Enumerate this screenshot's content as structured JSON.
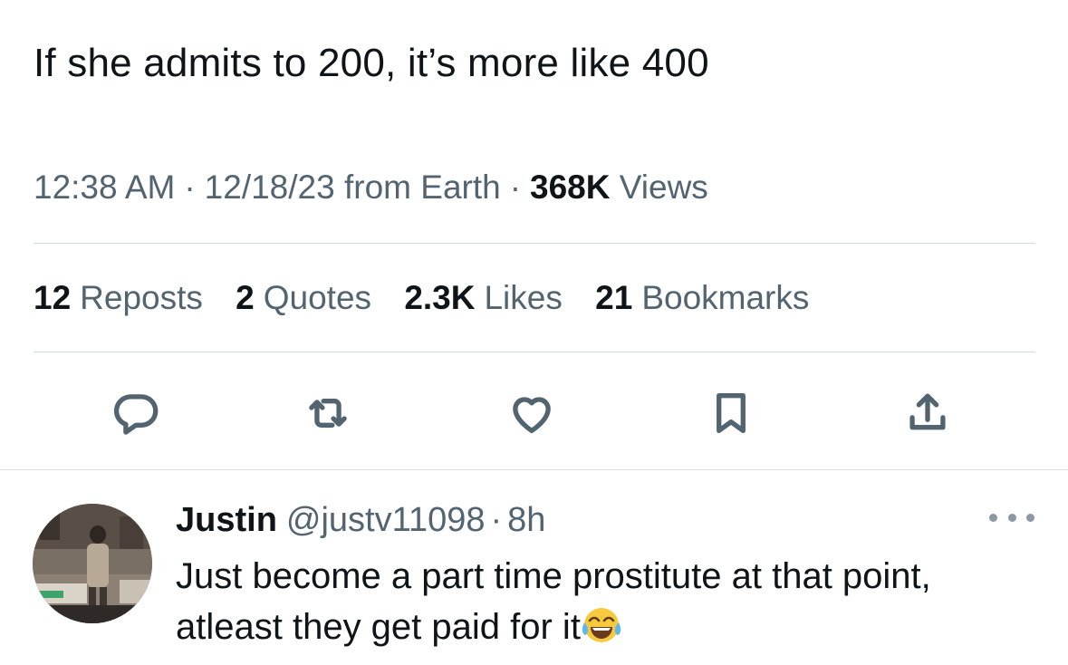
{
  "tweet": {
    "text": "If she admits to 200, it’s more like 400",
    "time": "12:38 AM",
    "date": "12/18/23",
    "source": "from Earth",
    "views_count": "368K",
    "views_label": "Views",
    "separator": "·"
  },
  "stats": [
    {
      "count": "12",
      "label": "Reposts"
    },
    {
      "count": "2",
      "label": "Quotes"
    },
    {
      "count": "2.3K",
      "label": "Likes"
    },
    {
      "count": "21",
      "label": "Bookmarks"
    }
  ],
  "actions": [
    "reply-icon",
    "repost-icon",
    "like-icon",
    "bookmark-icon",
    "share-icon"
  ],
  "reply": {
    "name": "Justin",
    "handle": "@justv11098",
    "separator": "·",
    "time": "8h",
    "text": "Just become a part time prostitute at that point, atleast they get paid for it",
    "emoji": "face-with-tears-of-joy"
  },
  "colors": {
    "text_primary": "#0f1419",
    "text_secondary": "#536471",
    "divider": "#cfd9de"
  }
}
